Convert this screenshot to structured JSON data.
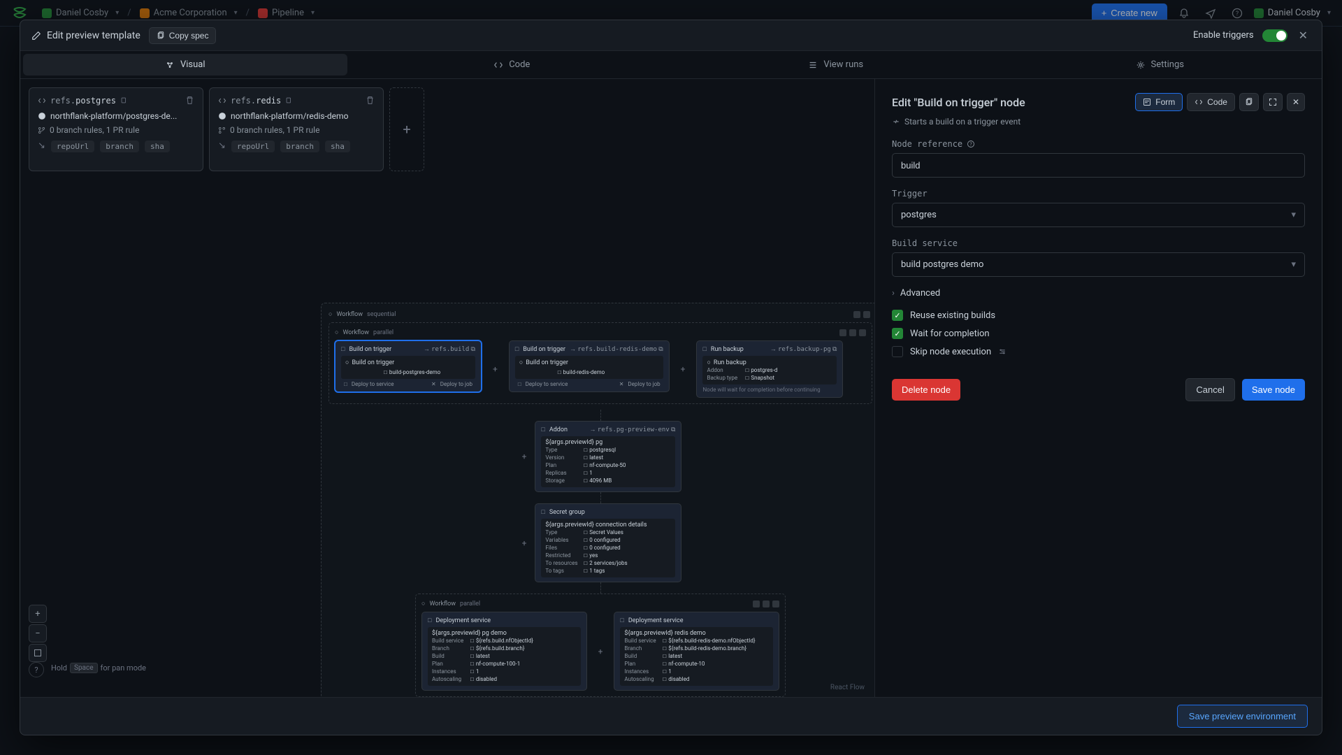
{
  "topbar": {
    "breadcrumb": [
      {
        "label": "Daniel Cosby",
        "avatar": "green"
      },
      {
        "label": "Acme Corporation",
        "avatar": "orange"
      },
      {
        "label": "Pipeline",
        "avatar": "red"
      }
    ],
    "create_label": "Create new",
    "user": "Daniel Cosby"
  },
  "modal": {
    "title": "Edit preview template",
    "copy_spec": "Copy spec",
    "enable_triggers": "Enable triggers",
    "tabs": [
      "Visual",
      "Code",
      "View runs",
      "Settings"
    ],
    "save_env": "Save preview environment"
  },
  "refs": [
    {
      "prefix": "refs.",
      "name": "postgres",
      "repo": "northflank-platform/postgres-de...",
      "branch_info": "0 branch rules, 1 PR rule",
      "tags": [
        "repoUrl",
        "branch",
        "sha"
      ]
    },
    {
      "prefix": "refs.",
      "name": "redis",
      "repo": "northflank-platform/redis-demo",
      "branch_info": "0 branch rules, 1 PR rule",
      "tags": [
        "repoUrl",
        "branch",
        "sha"
      ]
    }
  ],
  "graph": {
    "outer_label": "Workflow",
    "outer_kind": "sequential",
    "parallel1_label": "Workflow",
    "parallel1_kind": "parallel",
    "nodes_row1": [
      {
        "title": "Build on trigger",
        "ref": "refs.build",
        "body_title": "Build on trigger",
        "prop_val": "build-postgres-demo",
        "footer_left": "Deploy to service",
        "footer_right": "Deploy to job",
        "selected": true
      },
      {
        "title": "Build on trigger",
        "ref": "refs.build-redis-demo",
        "body_title": "Build on trigger",
        "prop_val": "build-redis-demo",
        "footer_left": "Deploy to service",
        "footer_right": "Deploy to job"
      },
      {
        "title": "Run backup",
        "ref": "refs.backup-pg",
        "body_title": "Run backup",
        "rows": [
          [
            "Addon",
            "postgres-d"
          ],
          [
            "Backup type",
            "Snapshot"
          ]
        ],
        "note": "Node will wait for completion before continuing"
      }
    ],
    "addon_node": {
      "title": "Addon",
      "ref": "refs.pg-preview-env",
      "body_title": "${args.previewId} pg",
      "rows": [
        [
          "Type",
          "postgresql"
        ],
        [
          "Version",
          "latest"
        ],
        [
          "Plan",
          "nf-compute-50"
        ],
        [
          "Replicas",
          "1"
        ],
        [
          "Storage",
          "4096 MB"
        ]
      ]
    },
    "secret_node": {
      "title": "Secret group",
      "body_title": "${args.previewId} connection details",
      "rows": [
        [
          "Type",
          "Secret Values"
        ],
        [
          "Variables",
          "0 configured"
        ],
        [
          "Files",
          "0 configured"
        ],
        [
          "Restricted",
          "yes"
        ],
        [
          "To resources",
          "2 services/jobs"
        ],
        [
          "To tags",
          "1 tags"
        ]
      ]
    },
    "parallel2_label": "Workflow",
    "parallel2_kind": "parallel",
    "deploy_left": {
      "title": "Deployment service",
      "body_title": "${args.previewId} pg demo",
      "rows": [
        [
          "Build service",
          "${refs.build.nfObjectId}"
        ],
        [
          "Branch",
          "${refs.build.branch}"
        ],
        [
          "Build",
          "latest"
        ],
        [
          "Plan",
          "nf-compute-100-1"
        ],
        [
          "Instances",
          "1"
        ],
        [
          "Autoscaling",
          "disabled"
        ]
      ]
    },
    "deploy_right": {
      "title": "Deployment service",
      "body_title": "${args.previewId} redis demo",
      "rows": [
        [
          "Build service",
          "${refs.build-redis-demo.nfObjectId}"
        ],
        [
          "Branch",
          "${refs.build-redis-demo.branch}"
        ],
        [
          "Build",
          "latest"
        ],
        [
          "Plan",
          "nf-compute-10"
        ],
        [
          "Instances",
          "1"
        ],
        [
          "Autoscaling",
          "disabled"
        ]
      ]
    }
  },
  "canvas": {
    "pan_hint_pre": "Hold",
    "pan_key": "Space",
    "pan_hint_post": "for pan mode",
    "attribution": "React Flow"
  },
  "panel": {
    "title": "Edit \"Build on trigger\" node",
    "form_tab": "Form",
    "code_tab": "Code",
    "subtitle": "Starts a build on a trigger event",
    "labels": {
      "node_ref": "Node reference",
      "trigger": "Trigger",
      "build_service": "Build service",
      "advanced": "Advanced"
    },
    "values": {
      "node_ref": "build",
      "trigger": "postgres",
      "build_service": "build postgres demo"
    },
    "checkboxes": [
      {
        "label": "Reuse existing builds",
        "checked": true
      },
      {
        "label": "Wait for completion",
        "checked": true
      },
      {
        "label": "Skip node execution",
        "checked": false,
        "icon": true
      }
    ],
    "actions": {
      "delete": "Delete node",
      "cancel": "Cancel",
      "save": "Save node"
    }
  }
}
